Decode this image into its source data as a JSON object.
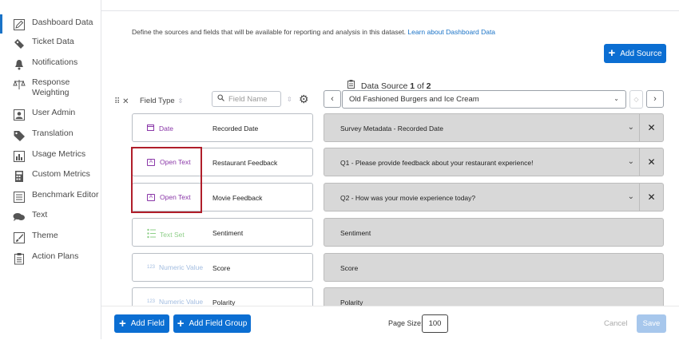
{
  "sidebar": {
    "items": [
      {
        "label": "Dashboard Data",
        "icon": "pencil-icon",
        "active": true
      },
      {
        "label": "Ticket Data",
        "icon": "ticket-icon"
      },
      {
        "label": "Notifications",
        "icon": "bell-icon"
      },
      {
        "label": "Response Weighting",
        "icon": "scale-icon"
      },
      {
        "label": "User Admin",
        "icon": "user-admin-icon"
      },
      {
        "label": "Translation",
        "icon": "tag-icon"
      },
      {
        "label": "Usage Metrics",
        "icon": "bar-chart-icon"
      },
      {
        "label": "Custom Metrics",
        "icon": "calculator-icon"
      },
      {
        "label": "Benchmark Editor",
        "icon": "list-icon"
      },
      {
        "label": "Text",
        "icon": "chat-icon"
      },
      {
        "label": "Theme",
        "icon": "paintbrush-icon"
      },
      {
        "label": "Action Plans",
        "icon": "clipboard-icon"
      }
    ]
  },
  "header": {
    "description": "Define the sources and fields that will be available for reporting and analysis in this dataset.",
    "learn_link": "Learn about Dashboard Data",
    "add_source": "Add Source"
  },
  "toolbar": {
    "field_type_label": "Field Type",
    "search_placeholder": "Field Name",
    "data_source_label": "Data Source",
    "data_source_current": "1",
    "data_source_of": "of",
    "data_source_total": "2",
    "data_source_value": "Old Fashioned Burgers and Ice Cream"
  },
  "fields": [
    {
      "type": "Date",
      "type_color": "#8a37a8",
      "icon": "calendar-icon",
      "name": "Recorded Date",
      "mapping": "Survey Metadata - Recorded Date",
      "mapped": true
    },
    {
      "type": "Open Text",
      "type_color": "#8a37a8",
      "icon": "text-field-icon",
      "name": "Restaurant Feedback",
      "mapping": "Q1 - Please provide feedback about your restaurant experience!",
      "mapped": true
    },
    {
      "type": "Open Text",
      "type_color": "#8a37a8",
      "icon": "text-field-icon",
      "name": "Movie Feedback",
      "mapping": "Q2 - How was your movie experience today?",
      "mapped": true
    },
    {
      "type": "Text Set",
      "type_color": "#8fcf8a",
      "icon": "list-set-icon",
      "name": "Sentiment",
      "mapping": "Sentiment",
      "mapped": false
    },
    {
      "type": "Numeric Value",
      "type_color": "#a3bde0",
      "icon": "numeric-icon",
      "name": "Score",
      "mapping": "Score",
      "mapped": false
    },
    {
      "type": "Numeric Value",
      "type_color": "#a3bde0",
      "icon": "numeric-icon",
      "name": "Polarity",
      "mapping": "Polarity",
      "mapped": false
    }
  ],
  "footer": {
    "add_field": "Add Field",
    "add_field_group": "Add Field Group",
    "page_size_label": "Page Size:",
    "page_size_value": "100",
    "cancel": "Cancel",
    "save": "Save"
  }
}
